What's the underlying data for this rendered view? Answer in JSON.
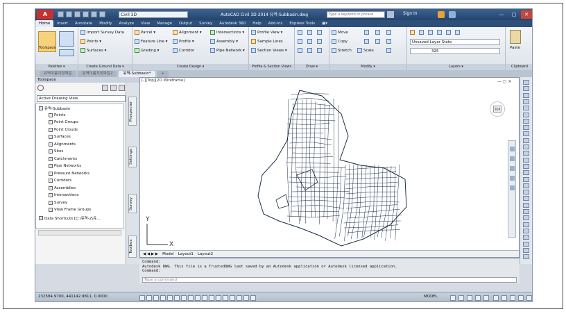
{
  "app": {
    "app_button": "A",
    "workspace": "Civil 3D",
    "window_title": "AutoCAD Civil 3D 2014    유역-Subbasin.dwg",
    "search_placeholder": "Type a keyword or phrase",
    "signin": "Sign In",
    "controls": [
      "—",
      "▢",
      "✕"
    ]
  },
  "ribbon": {
    "tabs": [
      "Home",
      "Insert",
      "Annotate",
      "Modify",
      "Analyze",
      "View",
      "Manage",
      "Output",
      "Survey",
      "Autodesk 360",
      "Help",
      "Add-ins",
      "Express Tools",
      "▣▾"
    ],
    "active_tab": "Home",
    "toolspace_label": "Toolspace",
    "palettes_title": "Palettes ▾",
    "ground": {
      "title": "Create Ground Data ▾",
      "items": [
        "Import Survey Data",
        "Points ▾",
        "Surfaces ▾"
      ]
    },
    "design": {
      "title": "Create Design ▾",
      "items": [
        "Parcel ▾",
        "Feature Line ▾",
        "Grading ▾",
        "Alignment ▾",
        "Profile ▾",
        "Corridor",
        "Intersections ▾",
        "Assembly ▾",
        "Pipe Network ▾"
      ]
    },
    "profile": {
      "title": "Profile & Section Views",
      "items": [
        "Profile View ▾",
        "Sample Lines",
        "Section Views ▾"
      ]
    },
    "draw": {
      "title": "Draw ▾"
    },
    "modify": {
      "title": "Modify ▾",
      "items": [
        "Move",
        "Copy",
        "Stretch",
        "Scale"
      ]
    },
    "layers": {
      "title": "Layers ▾",
      "state": "Unsaved Layer State",
      "current": "325"
    },
    "clipboard": {
      "title": "Clipboard",
      "paste": "Paste"
    }
  },
  "doc_tabs": [
    "유역이름지정파일",
    "유역이름지정파일2",
    "유역-Subbasin*",
    "+"
  ],
  "toolspace": {
    "title": "Toolspace",
    "view_select": "Active Drawing View",
    "tree": [
      {
        "label": "유역-Subbasin",
        "level": 0
      },
      {
        "label": "Points",
        "level": 1
      },
      {
        "label": "Point Groups",
        "level": 1
      },
      {
        "label": "Point Clouds",
        "level": 1
      },
      {
        "label": "Surfaces",
        "level": 1
      },
      {
        "label": "Alignments",
        "level": 1
      },
      {
        "label": "Sites",
        "level": 1
      },
      {
        "label": "Catchments",
        "level": 1
      },
      {
        "label": "Pipe Networks",
        "level": 1
      },
      {
        "label": "Pressure Networks",
        "level": 1
      },
      {
        "label": "Corridors",
        "level": 1
      },
      {
        "label": "Assemblies",
        "level": 1
      },
      {
        "label": "Intersections",
        "level": 1
      },
      {
        "label": "Survey",
        "level": 1
      },
      {
        "label": "View Frame Groups",
        "level": 1
      },
      {
        "label": "Data Shortcuts [C:\\유역-2\\유...",
        "level": 0
      }
    ],
    "side_tabs": [
      "Prospector",
      "Settings",
      "Survey",
      "Toolbox"
    ]
  },
  "viewport": {
    "label": "[-][Top][2D Wireframe]",
    "window_controls": "— ▢ ✕",
    "navcube_label": "TOP",
    "layout_tabs": [
      "◀ ◀ ▶ ▶",
      "Model",
      "Layout1",
      "Layout2"
    ]
  },
  "command": {
    "history": [
      "Command:",
      "Autodesk DWG.  This file is a TrustedDWG last saved by an Autodesk application or Autodesk licensed application.",
      "Command:"
    ],
    "placeholder": "Type a command"
  },
  "status": {
    "coords": "232584.9700, 441142.9811, 0.0000",
    "model": "MODEL"
  },
  "colors": {
    "title_bar": "#2d4f79",
    "app_red": "#c83030",
    "mesh": "#1a2a44"
  }
}
